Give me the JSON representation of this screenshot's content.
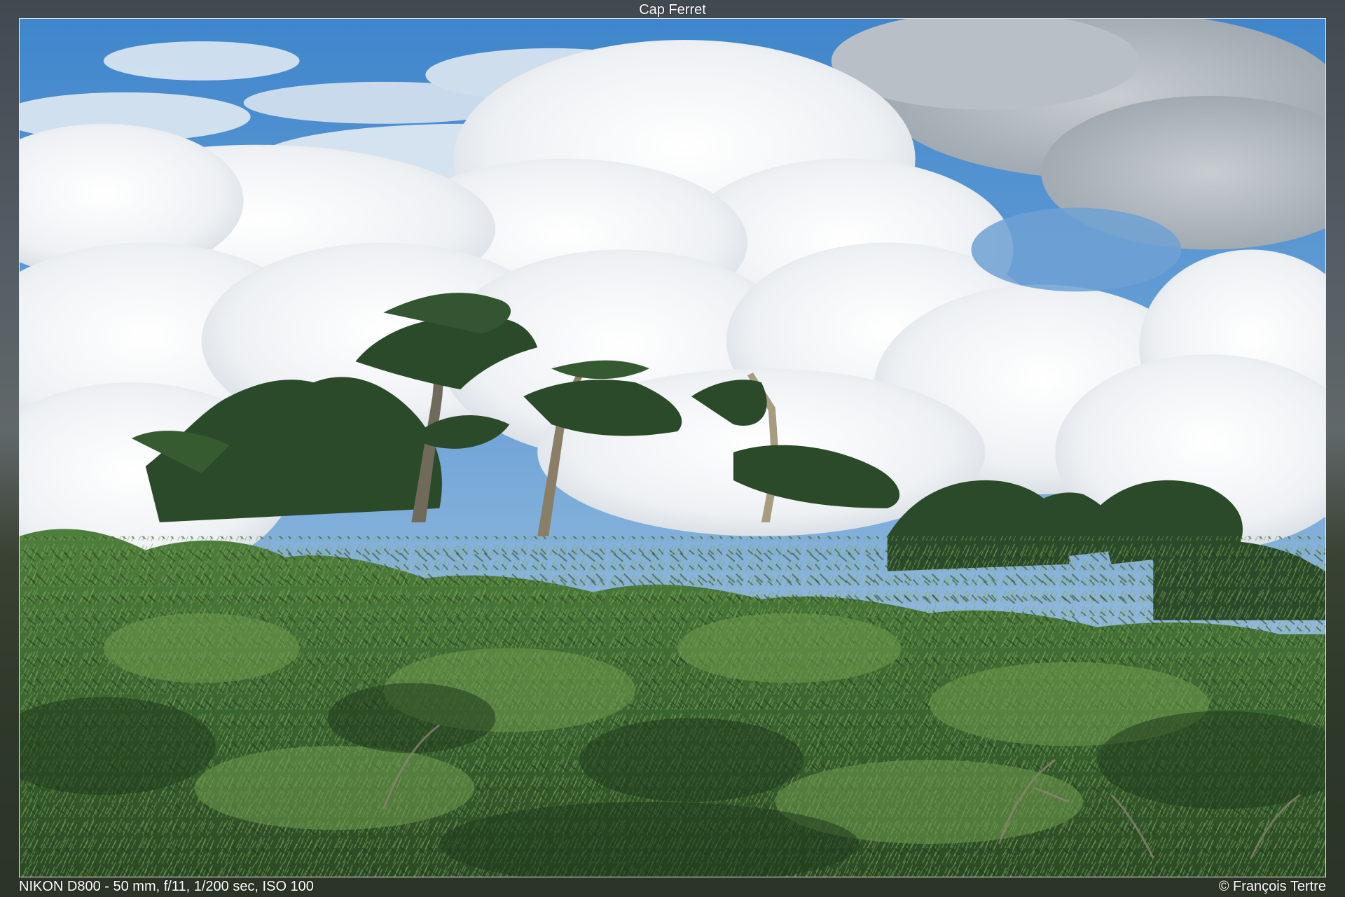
{
  "photo": {
    "title": "Cap Ferret",
    "exif": "NIKON D800 - 50 mm, f/11, 1/200 sec, ISO 100",
    "copyright": "© François Tertre"
  },
  "colors": {
    "sky": "#4b8fd1",
    "cloud": "#f2f4f6",
    "foliage_dark": "#1f3a1f",
    "foliage_mid": "#3d6b34",
    "foliage_light": "#6f9950"
  }
}
